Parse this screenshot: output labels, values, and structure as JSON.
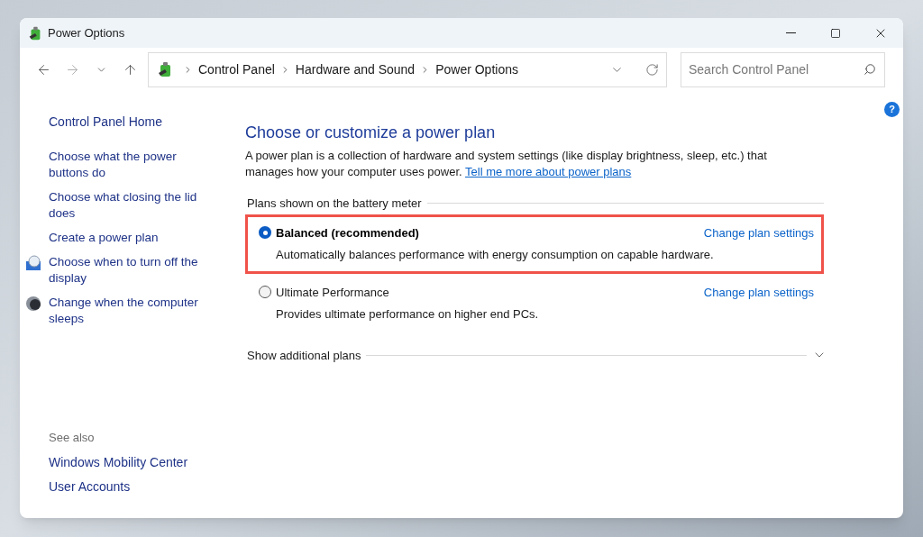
{
  "window": {
    "title": "Power Options"
  },
  "address_bar": {
    "crumbs": [
      "Control Panel",
      "Hardware and Sound",
      "Power Options"
    ]
  },
  "search": {
    "placeholder": "Search Control Panel"
  },
  "help_button": "?",
  "sidebar": {
    "home": "Control Panel Home",
    "items": [
      {
        "label": "Choose what the power buttons do",
        "kind": "plain"
      },
      {
        "label": "Choose what closing the lid does",
        "kind": "plain"
      },
      {
        "label": "Create a power plan",
        "kind": "plain"
      },
      {
        "label": "Choose when to turn off the display",
        "kind": "display"
      },
      {
        "label": "Change when the computer sleeps",
        "kind": "sleep"
      }
    ],
    "see_also": {
      "heading": "See also",
      "items": [
        "Windows Mobility Center",
        "User Accounts"
      ]
    }
  },
  "main": {
    "title": "Choose or customize a power plan",
    "description": "A power plan is a collection of hardware and system settings (like display brightness, sleep, etc.) that manages how your computer uses power.",
    "link": "Tell me more about power plans",
    "group_label": "Plans shown on the battery meter",
    "plans": [
      {
        "name": "Balanced (recommended)",
        "selected": true,
        "highlighted": true,
        "description": "Automatically balances performance with energy consumption on capable hardware.",
        "action": "Change plan settings"
      },
      {
        "name": "Ultimate Performance",
        "selected": false,
        "highlighted": false,
        "description": "Provides ultimate performance on higher end PCs.",
        "action": "Change plan settings"
      }
    ],
    "more": {
      "label": "Show additional plans",
      "expanded": false
    }
  }
}
